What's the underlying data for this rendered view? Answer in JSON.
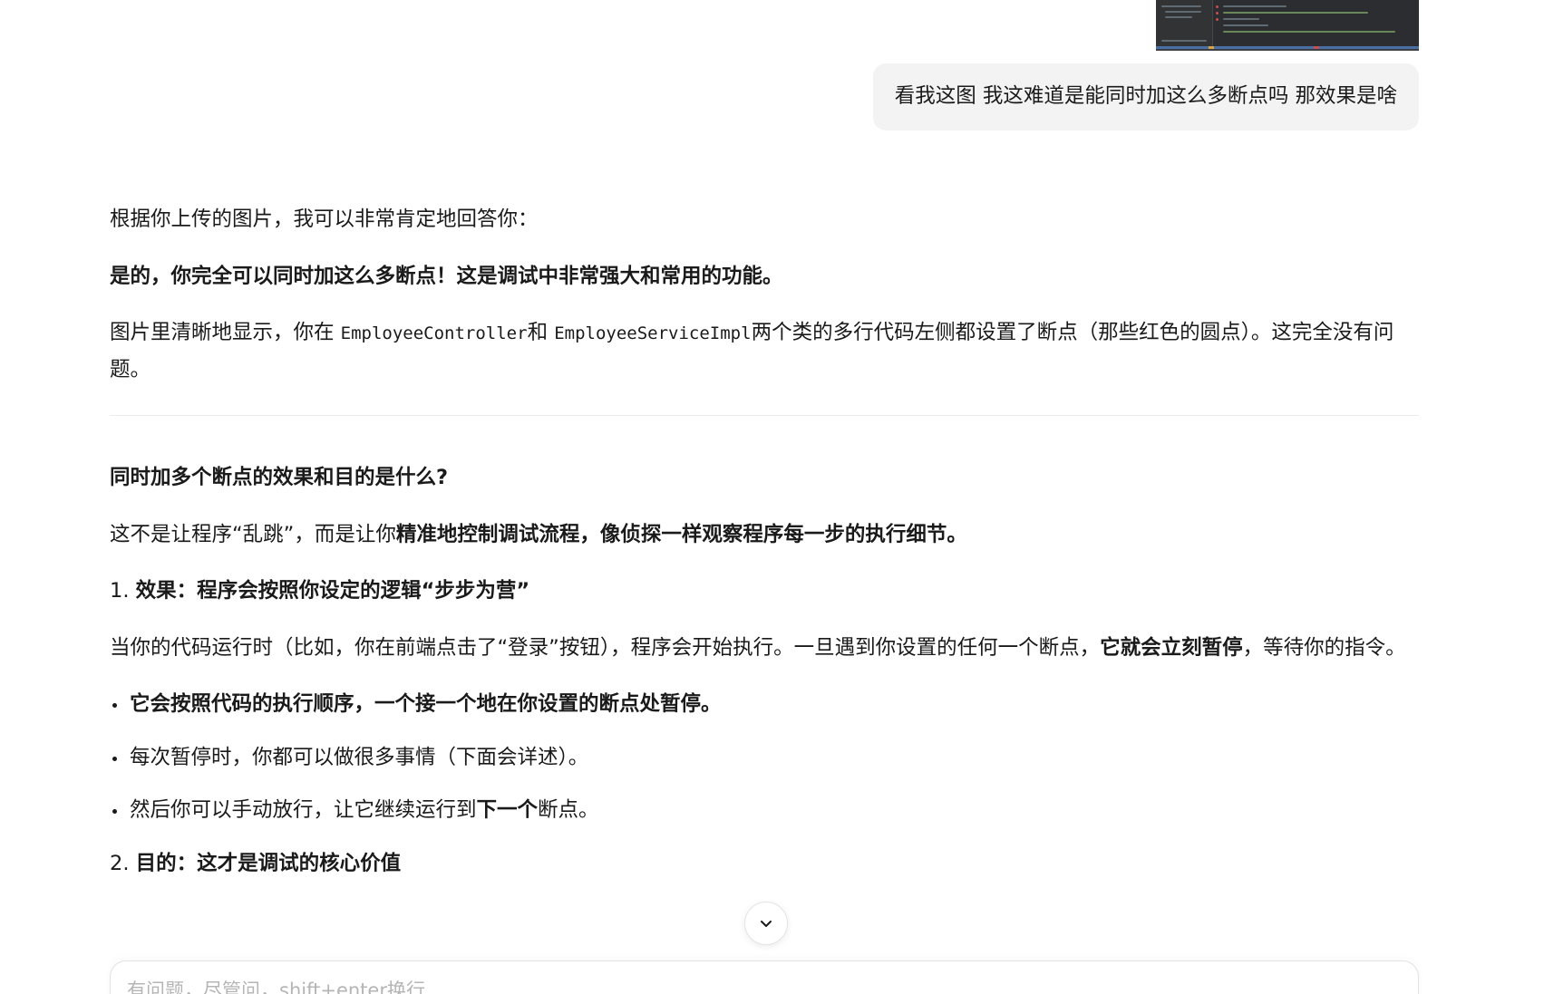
{
  "user_message": {
    "text": "看我这图 我这难道是能同时加这么多断点吗 那效果是啥"
  },
  "answer": {
    "intro": "根据你上传的图片，我可以非常肯定地回答你：",
    "bold_yes": "是的，你完全可以同时加这么多断点！这是调试中非常强大和常用的功能。",
    "para1_a": "图片里清晰地显示，你在 ",
    "para1_code1": "EmployeeController",
    "para1_b": "和 ",
    "para1_code2": "EmployeeServiceImpl",
    "para1_c": "两个类的多行代码左侧都设置了断点（那些红色的圆点）。这完全没有问题。",
    "section_title": "同时加多个断点的效果和目的是什么?",
    "para2_a": "这不是让程序“乱跳”，而是让你",
    "para2_bold": "精准地控制调试流程，像侦探一样观察程序每一步的执行细节。",
    "point1_num": "1. ",
    "point1_title": "效果：程序会按照你设定的逻辑“步步为营”",
    "para3_a": "当你的代码运行时（比如，你在前端点击了“登录”按钮），程序会开始执行。一旦遇到你设置的任何一个断点，",
    "para3_bold": "它就会立刻暂停",
    "para3_b": "，等待你的指令。",
    "bullets": {
      "b1": "它会按照代码的执行顺序，一个接一个地在你设置的断点处暂停。",
      "b2": "每次暂停时，你都可以做很多事情（下面会详述）。",
      "b3_a": "然后你可以手动放行，让它继续运行到",
      "b3_bold": "下一个",
      "b3_b": "断点。"
    },
    "point2_num": "2. ",
    "point2_title": "目的：这才是调试的核心价值"
  },
  "input": {
    "placeholder": "有问题，尽管问，shift+enter换行"
  },
  "icons": {
    "scroll_down": "chevron-down-icon"
  }
}
